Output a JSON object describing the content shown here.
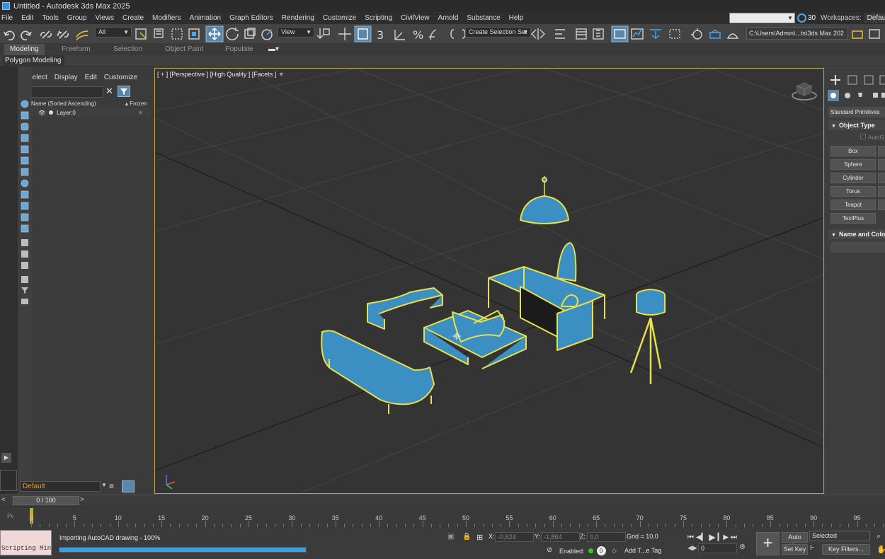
{
  "window": {
    "title": "Untitled - Autodesk 3ds Max 2025"
  },
  "menu": [
    "File",
    "Edit",
    "Tools",
    "Group",
    "Views",
    "Create",
    "Modifiers",
    "Animation",
    "Graph Editors",
    "Rendering",
    "Customize",
    "Scripting",
    "CivilView",
    "Arnold",
    "Substance",
    "Help"
  ],
  "header_right": {
    "cloud_count": "30",
    "workspaces_label": "Workspaces:",
    "workspace_value": "Default"
  },
  "toolbar": {
    "filter_value": "All",
    "ref_coord": "View",
    "selection_set": "Create Selection Set",
    "project_path": "C:\\Users\\Admin\\...ts\\3ds Max 202"
  },
  "ribbon": {
    "tabs": [
      "Modeling",
      "Freeform",
      "Selection",
      "Object Paint",
      "Populate"
    ],
    "active": "Modeling",
    "subtab": "Polygon Modeling"
  },
  "explorer": {
    "menu": [
      "Select",
      "Display",
      "Edit",
      "Customize"
    ],
    "col_name": "Name (Sorted Ascending)",
    "col_frozen": "▴ Frozen",
    "row_label": "Layer:0",
    "layer_value": "Default"
  },
  "viewport": {
    "label": "[ + ] [Perspective ] [High Quality ] [Facets ]",
    "object_color": "#3b8fc2",
    "selection_color": "#e8e04a"
  },
  "command_panel": {
    "category": "Standard Primitives",
    "object_type_title": "Object Type",
    "autogrid": "AutoG",
    "buttons": [
      "Box",
      "Sphere",
      "Cylinder",
      "Torus",
      "Teapot",
      "TextPlus"
    ],
    "name_color_title": "Name and Color"
  },
  "timeline": {
    "frame_display": "0 / 100",
    "prev": "<",
    "next": ">",
    "ticks": [
      "0",
      "5",
      "10",
      "15",
      "20",
      "25",
      "30",
      "35",
      "40",
      "45",
      "50",
      "55",
      "60",
      "65",
      "70",
      "75",
      "80",
      "85",
      "90",
      "95"
    ]
  },
  "status": {
    "script_mini": "Scripting Mini",
    "message": "Importing AutoCAD drawing  -  100%",
    "progress": 1.0,
    "x_label": "X:",
    "x_value": "-0,624",
    "y_label": "Y:",
    "y_value": "-1,864",
    "z_label": "Z:",
    "z_value": "0,0",
    "grid": "Grid = 10,0",
    "enabled": "Enabled:",
    "add_time_tag": "Add T...e Tag",
    "auto_key": "Auto Key",
    "set_key": "Set Key",
    "key_mode": "Selected",
    "key_filters": "Key Filters...",
    "frame": "0"
  }
}
